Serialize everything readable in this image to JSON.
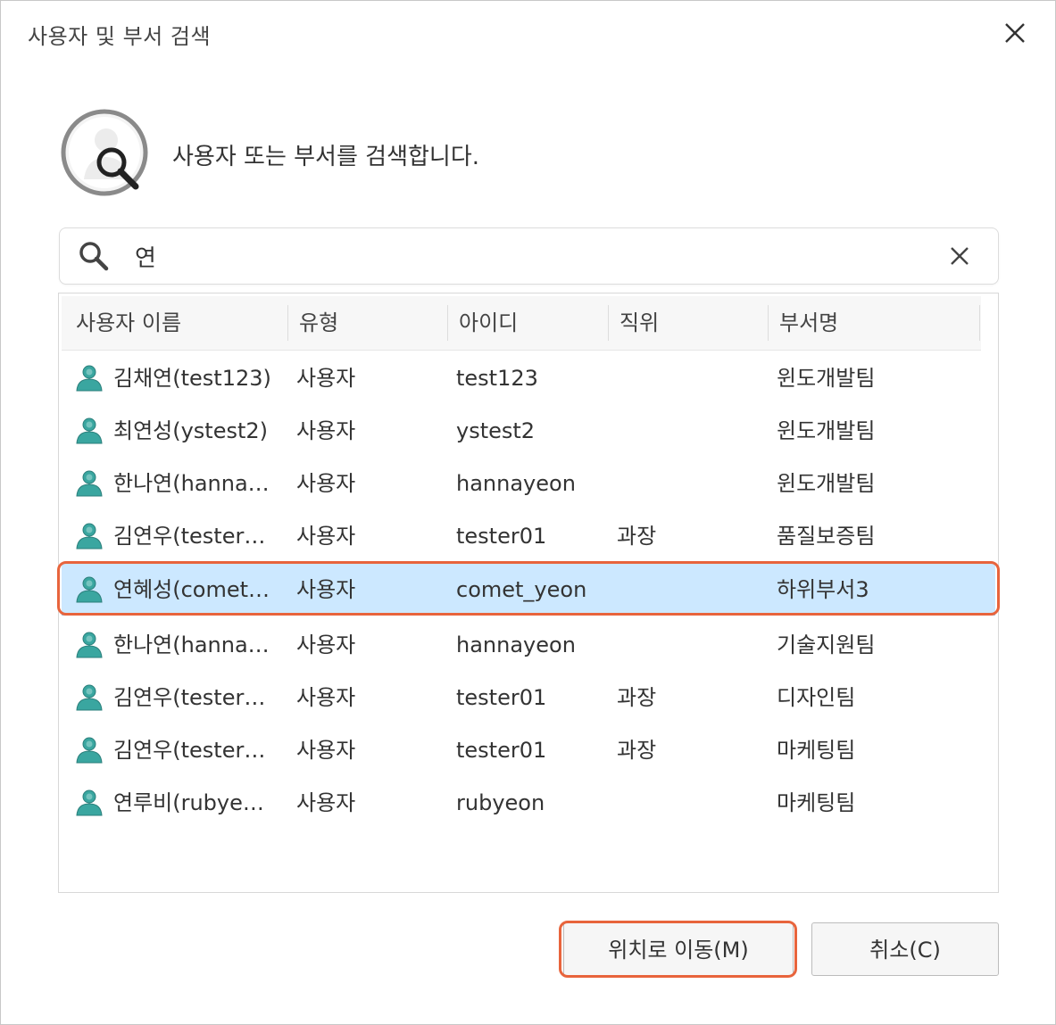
{
  "window": {
    "title": "사용자 및 부서 검색"
  },
  "header": {
    "description": "사용자 또는 부서를 검색합니다."
  },
  "search": {
    "value": "연",
    "placeholder": ""
  },
  "table": {
    "columns": [
      "사용자 이름",
      "유형",
      "아이디",
      "직위",
      "부서명"
    ],
    "rows": [
      {
        "name": "김채연(test123)",
        "type": "사용자",
        "id": "test123",
        "position": "",
        "dept": "윈도개발팀"
      },
      {
        "name": "최연성(ystest2)",
        "type": "사용자",
        "id": "ystest2",
        "position": "",
        "dept": "윈도개발팀"
      },
      {
        "name": "한나연(hanna…",
        "type": "사용자",
        "id": "hannayeon",
        "position": "",
        "dept": "윈도개발팀"
      },
      {
        "name": "김연우(tester…",
        "type": "사용자",
        "id": "tester01",
        "position": "과장",
        "dept": "품질보증팀"
      },
      {
        "name": "연혜성(comet…",
        "type": "사용자",
        "id": "comet_yeon",
        "position": "",
        "dept": "하위부서3",
        "selected": true
      },
      {
        "name": "한나연(hanna…",
        "type": "사용자",
        "id": "hannayeon",
        "position": "",
        "dept": "기술지원팀"
      },
      {
        "name": "김연우(tester…",
        "type": "사용자",
        "id": "tester01",
        "position": "과장",
        "dept": "디자인팀"
      },
      {
        "name": "김연우(tester…",
        "type": "사용자",
        "id": "tester01",
        "position": "과장",
        "dept": "마케팅팀"
      },
      {
        "name": "연루비(rubye…",
        "type": "사용자",
        "id": "rubyeon",
        "position": "",
        "dept": "마케팅팀"
      }
    ]
  },
  "buttons": {
    "move": "위치로 이동(M)",
    "cancel": "취소(C)"
  },
  "icons": {
    "close": "close-icon",
    "header": "user-search-icon",
    "search": "search-icon",
    "clear": "clear-icon",
    "user": "user-icon"
  },
  "colors": {
    "selection_bg": "#cce8ff",
    "highlight_border": "#e8643c",
    "user_icon": "#3aa6a0"
  }
}
